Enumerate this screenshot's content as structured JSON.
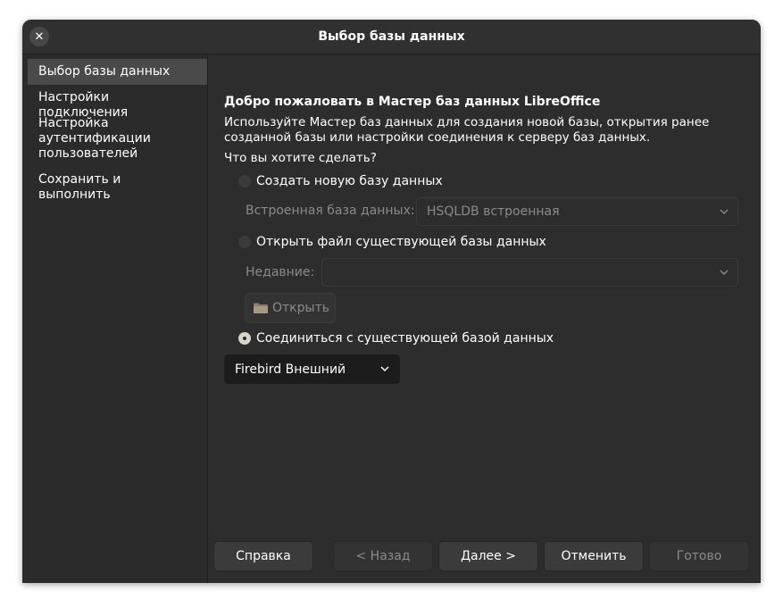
{
  "window": {
    "title": "Выбор базы данных"
  },
  "sidebar": {
    "items": [
      {
        "label": "Выбор базы данных",
        "active": true
      },
      {
        "label": "Настройки подключения"
      },
      {
        "label": "Настройка аутентификации пользователей"
      },
      {
        "label": "Сохранить и выполнить"
      }
    ]
  },
  "main": {
    "heading": "Добро пожаловать в Мастер баз данных LibreOffice",
    "description": "Используйте Мастер баз данных для создания новой базы, открытия ранее созданной базы или настройки соединения к серверу баз данных.",
    "question": "Что вы хотите сделать?",
    "option_create": {
      "label": "Создать новую базу данных",
      "checked": false
    },
    "embedded": {
      "label": "Встроенная база данных:",
      "value": "HSQLDB встроенная"
    },
    "option_open": {
      "label": "Открыть файл существующей базы данных",
      "checked": false
    },
    "recent": {
      "label": "Недавние:",
      "value": ""
    },
    "open_button": "Открыть",
    "option_connect": {
      "label": "Соединиться с существующей базой данных",
      "checked": true
    },
    "connection_type": "Firebird Внешний"
  },
  "buttons": {
    "help": "Справка",
    "back": "< Назад",
    "next": "Далее >",
    "cancel": "Отменить",
    "finish": "Готово"
  },
  "colors": {
    "window_bg": "#2b2b2b",
    "selected_item": "#4a4a4a",
    "text": "#ffffff",
    "disabled_text": "#8a8a8a"
  },
  "icons": [
    "close-icon",
    "chevron-down-icon",
    "folder-icon"
  ]
}
